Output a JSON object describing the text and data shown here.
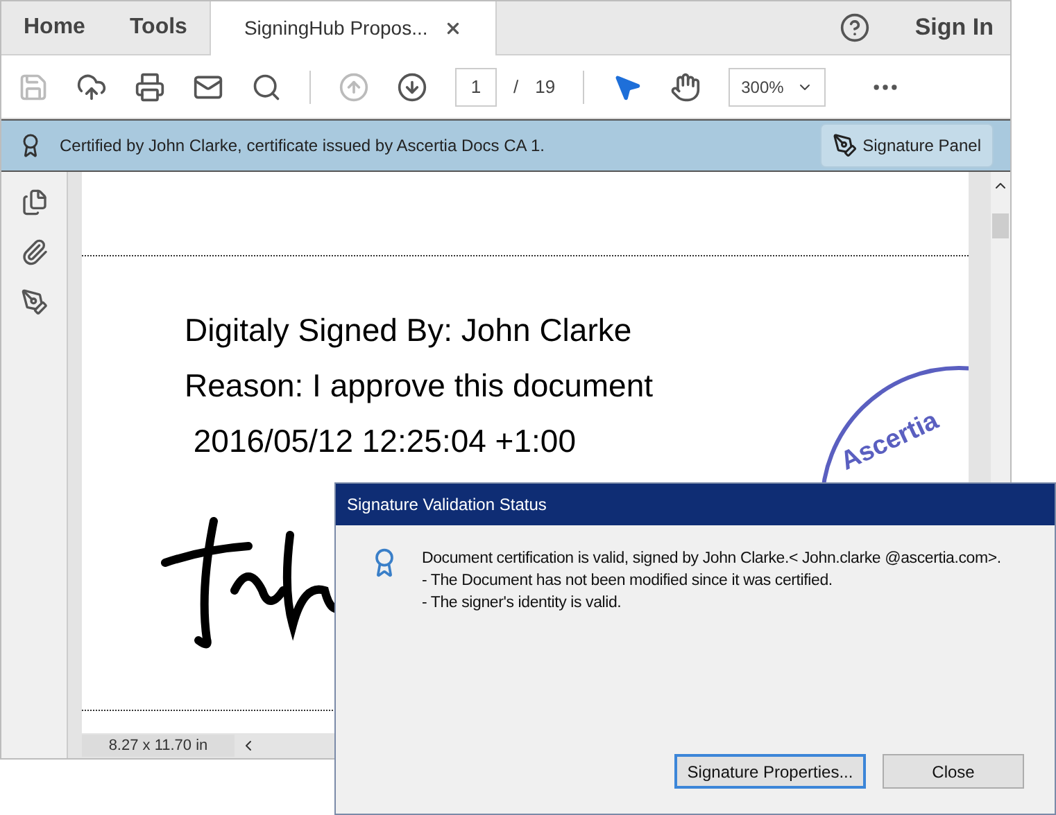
{
  "tabs": [
    {
      "label": "Home",
      "selected": false
    },
    {
      "label": "Tools",
      "selected": false
    },
    {
      "label": "SigningHub Propos...",
      "selected": true,
      "closable": true
    }
  ],
  "sign_in": "Sign In",
  "toolbar": {
    "tools": [
      {
        "kind": "save",
        "disabled": true
      },
      {
        "kind": "upload",
        "disabled": false
      },
      {
        "kind": "print",
        "disabled": false
      },
      {
        "kind": "mail",
        "disabled": false
      },
      {
        "kind": "search",
        "disabled": false
      }
    ],
    "nav": [
      {
        "kind": "up",
        "disabled": true
      },
      {
        "kind": "down",
        "disabled": false
      }
    ],
    "page": "1",
    "separator": "/",
    "total": "19",
    "modes": [
      {
        "kind": "pointer",
        "selected": true
      },
      {
        "kind": "hand",
        "selected": false
      }
    ],
    "zoom": "300%"
  },
  "banner": {
    "text": "Certified by John Clarke, certificate issued by Ascertia Docs CA 1.",
    "button": "Signature Panel"
  },
  "document": {
    "lines": [
      "Digitaly Signed By: John Clarke",
      "Reason: I approve this document",
      " 2016/05/12 12:25:04 +1:00"
    ],
    "stamp": "Ascertia"
  },
  "status_bar": {
    "page_size": "8.27 x 11.70 in"
  },
  "dialog": {
    "title": "Signature Validation Status",
    "lines": [
      "Document certification is valid, signed by John Clarke.< John.clarke @ascertia.com>.",
      "- The Document has not been modified since it was certified.",
      "- The signer's identity is valid."
    ],
    "buttons": [
      {
        "label": "Signature Properties...",
        "selected": true
      },
      {
        "label": "Close",
        "selected": false
      }
    ]
  }
}
